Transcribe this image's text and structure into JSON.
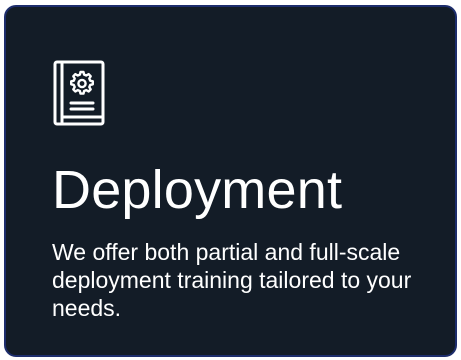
{
  "card": {
    "icon": "book-gear-icon",
    "title": "Deployment",
    "description": "We offer both partial and full-scale deployment training tailored to your needs.",
    "colors": {
      "background": "#131c27",
      "border": "#1d2d6c",
      "text": "#ffffff"
    }
  }
}
